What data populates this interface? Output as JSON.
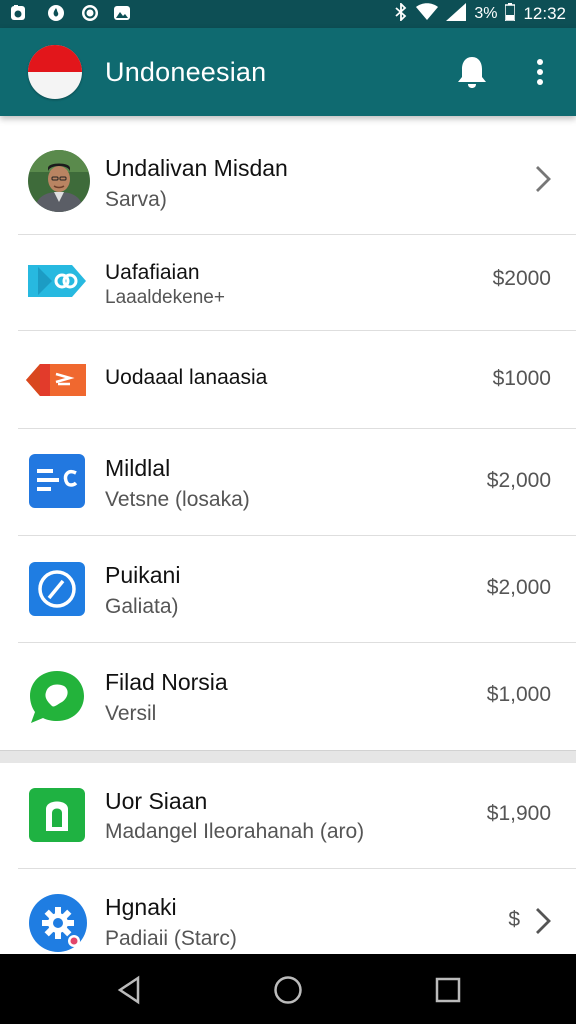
{
  "status_bar": {
    "battery_text": "3%",
    "time": "12:32",
    "icons": [
      "camera-icon",
      "fire-icon",
      "shield-icon",
      "image-icon",
      "bluetooth-icon",
      "wifi-icon",
      "signal-icon",
      "battery-icon"
    ]
  },
  "app_bar": {
    "title": "Undoneesian",
    "flag_colors": [
      "#e2161b",
      "#f4f4f4"
    ],
    "actions": [
      "bell-icon",
      "more-vert-icon"
    ]
  },
  "profile": {
    "name": "Undalivan Misdan",
    "subtitle": "Sarva)"
  },
  "items": [
    {
      "title": "Uafafiaian",
      "subtitle": "Laaaldekene+",
      "amount": "$2000",
      "icon": "chain-link-icon",
      "color": "#27b9e0"
    },
    {
      "title": "Uodaaal lanaasia",
      "subtitle": "",
      "amount": "$1000",
      "icon": "send-tag-icon",
      "color": "#f0682f"
    },
    {
      "title": "Mildlal",
      "subtitle": "Vetsne (losaka)",
      "amount": "$2,000",
      "icon": "document-icon",
      "color": "#2278e0"
    },
    {
      "title": "Puikani",
      "subtitle": "Galiata)",
      "amount": "$2,000",
      "icon": "compass-icon",
      "color": "#1f7de2"
    },
    {
      "title": "Filad Norsia",
      "subtitle": "Versil",
      "amount": "$1,000",
      "icon": "chat-bubble-icon",
      "color": "#23b33b"
    }
  ],
  "items_section2": [
    {
      "title": "Uor Siaan",
      "subtitle": "Madangel Ileorahanah (aro)",
      "amount": "$1,900",
      "icon": "contact-icon",
      "color": "#1fb242"
    },
    {
      "title": "Hgnaki",
      "subtitle": "Padiaii (Starc)",
      "amount": "$",
      "icon": "settings-gear-icon",
      "color": "#1f7de2"
    }
  ],
  "nav_bar": [
    "back-icon",
    "home-icon",
    "recents-icon"
  ]
}
